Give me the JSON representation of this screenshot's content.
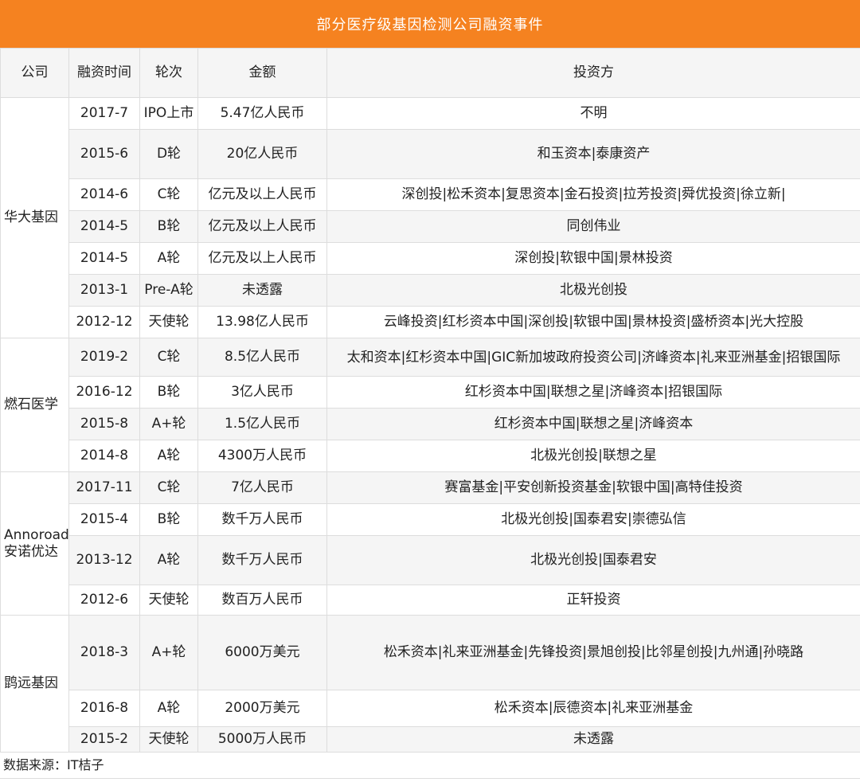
{
  "title": "部分医疗级基因检测公司融资事件",
  "headers": {
    "company": "公司",
    "date": "融资时间",
    "round": "轮次",
    "amount": "金额",
    "investors": "投资方"
  },
  "companies": [
    {
      "name": "华大基因",
      "rows": [
        {
          "date": "2017-7",
          "round": "IPO上市",
          "amount": "5.47亿人民币",
          "investors": "不明"
        },
        {
          "date": "2015-6",
          "round": "D轮",
          "amount": "20亿人民币",
          "investors": "和玉资本|泰康资产"
        },
        {
          "date": "2014-6",
          "round": "C轮",
          "amount": "亿元及以上人民币",
          "investors": "深创投|松禾资本|复思资本|金石投资|拉芳投资|舜优投资|徐立新|"
        },
        {
          "date": "2014-5",
          "round": "B轮",
          "amount": "亿元及以上人民币",
          "investors": "同创伟业"
        },
        {
          "date": "2014-5",
          "round": "A轮",
          "amount": "亿元及以上人民币",
          "investors": "深创投|软银中国|景林投资"
        },
        {
          "date": "2013-1",
          "round": "Pre-A轮",
          "amount": "未透露",
          "investors": "北极光创投"
        },
        {
          "date": "2012-12",
          "round": "天使轮",
          "amount": "13.98亿人民币",
          "investors": "云峰投资|红杉资本中国|深创投|软银中国|景林投资|盛桥资本|光大控股"
        }
      ]
    },
    {
      "name": "燃石医学",
      "rows": [
        {
          "date": "2019-2",
          "round": "C轮",
          "amount": "8.5亿人民币",
          "investors": "太和资本|红杉资本中国|GIC新加坡政府投资公司|济峰资本|礼来亚洲基金|招银国际"
        },
        {
          "date": "2016-12",
          "round": "B轮",
          "amount": "3亿人民币",
          "investors": "红杉资本中国|联想之星|济峰资本|招银国际"
        },
        {
          "date": "2015-8",
          "round": "A+轮",
          "amount": "1.5亿人民币",
          "investors": "红杉资本中国|联想之星|济峰资本"
        },
        {
          "date": "2014-8",
          "round": "A轮",
          "amount": "4300万人民币",
          "investors": "北极光创投|联想之星"
        }
      ]
    },
    {
      "name_line1": "Annoroad",
      "name_line2": "安诺优达",
      "rows": [
        {
          "date": "2017-11",
          "round": "C轮",
          "amount": "7亿人民币",
          "investors": "赛富基金|平安创新投资基金|软银中国|高特佳投资"
        },
        {
          "date": "2015-4",
          "round": "B轮",
          "amount": "数千万人民币",
          "investors": "北极光创投|国泰君安|崇德弘信"
        },
        {
          "date": "2013-12",
          "round": "A轮",
          "amount": "数千万人民币",
          "investors": "北极光创投|国泰君安"
        },
        {
          "date": "2012-6",
          "round": "天使轮",
          "amount": "数百万人民币",
          "investors": "正轩投资"
        }
      ]
    },
    {
      "name": "鹍远基因",
      "rows": [
        {
          "date": "2018-3",
          "round": "A+轮",
          "amount": "6000万美元",
          "investors": "松禾资本|礼来亚洲基金|先锋投资|景旭创投|比邻星创投|九州通|孙晓路"
        },
        {
          "date": "2016-8",
          "round": "A轮",
          "amount": "2000万美元",
          "investors": "松禾资本|辰德资本|礼来亚洲基金"
        },
        {
          "date": "2015-2",
          "round": "天使轮",
          "amount": "5000万人民币",
          "investors": "未透露"
        }
      ]
    }
  ],
  "footer": "数据来源：IT桔子",
  "colors": {
    "title_bg": "#f58220",
    "alt_row": "#f5f5f5",
    "border": "#dddddd"
  }
}
